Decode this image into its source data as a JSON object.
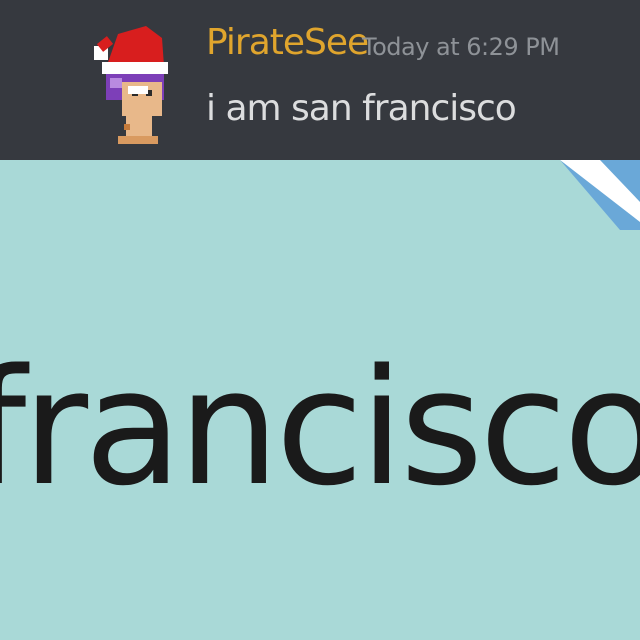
{
  "message": {
    "username": "PirateSee",
    "timestamp": "Today at 6:29 PM",
    "text": "i am san francisco",
    "avatar_icon": "pirate-avatar-santa-hat"
  },
  "map": {
    "label": "francisco"
  },
  "colors": {
    "header_bg": "#36393f",
    "username": "#e0a52d",
    "timestamp": "#8e9297",
    "message_text": "#dcddde",
    "map_water": "#a9d9d7",
    "map_road": "#ffffff",
    "map_road_edge": "#6aa8d8"
  }
}
